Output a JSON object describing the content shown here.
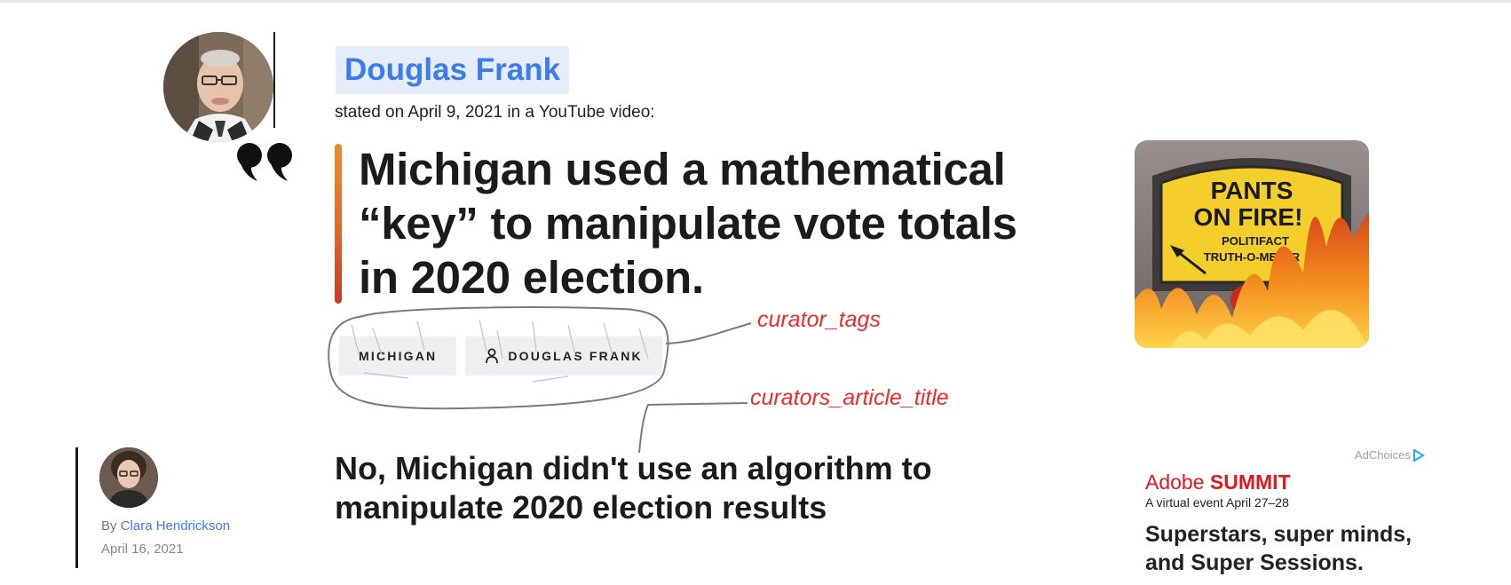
{
  "speaker": {
    "name": "Douglas Frank",
    "stated_line": "stated on April 9, 2021 in a YouTube video:"
  },
  "statement": {
    "lines": [
      "Michigan used a mathematical",
      "“key” to manipulate vote totals",
      "in 2020 election."
    ]
  },
  "rating": {
    "meter_line1": "PANTS",
    "meter_line2": "ON FIRE!",
    "meter_line3": "POLITIFACT",
    "meter_line4": "TRUTH-O-METER"
  },
  "tags": [
    {
      "label": "MICHIGAN",
      "icon": ""
    },
    {
      "label": "DOUGLAS FRANK",
      "icon": "person-icon"
    }
  ],
  "annotations": {
    "curator_tags": "curator_tags",
    "curators_article_title": "curators_article_title",
    "color": "#ee2a2a"
  },
  "article": {
    "title_line1": "No, Michigan didn't use an algorithm to",
    "title_line2": "manipulate 2020 election results"
  },
  "author": {
    "by": "By",
    "name": "Clara Hendrickson",
    "date": "April 16, 2021"
  },
  "ad": {
    "adchoices": "AdChoices",
    "brand_prefix": "Adobe",
    "brand_bold": "SUMMIT",
    "sub": "A virtual event April 27–28",
    "headline_line1": "Superstars, super minds,",
    "headline_line2": "and Super Sessions."
  },
  "colors": {
    "accent_blue": "#3b7bea",
    "speaker_bg": "#e4edf9",
    "statement_bar": "#e0672a"
  }
}
